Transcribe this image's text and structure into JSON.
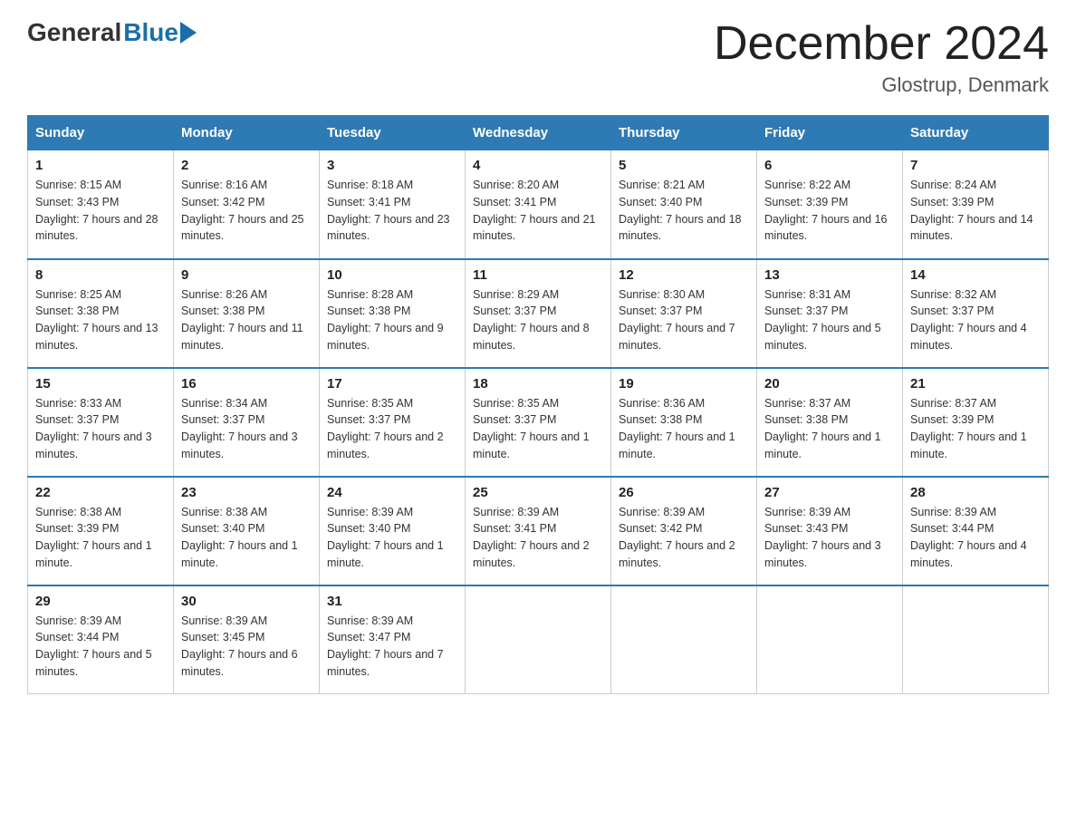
{
  "header": {
    "logo_general": "General",
    "logo_blue": "Blue",
    "title": "December 2024",
    "location": "Glostrup, Denmark"
  },
  "calendar": {
    "days_of_week": [
      "Sunday",
      "Monday",
      "Tuesday",
      "Wednesday",
      "Thursday",
      "Friday",
      "Saturday"
    ],
    "weeks": [
      [
        {
          "day": "1",
          "sunrise": "8:15 AM",
          "sunset": "3:43 PM",
          "daylight": "7 hours and 28 minutes."
        },
        {
          "day": "2",
          "sunrise": "8:16 AM",
          "sunset": "3:42 PM",
          "daylight": "7 hours and 25 minutes."
        },
        {
          "day": "3",
          "sunrise": "8:18 AM",
          "sunset": "3:41 PM",
          "daylight": "7 hours and 23 minutes."
        },
        {
          "day": "4",
          "sunrise": "8:20 AM",
          "sunset": "3:41 PM",
          "daylight": "7 hours and 21 minutes."
        },
        {
          "day": "5",
          "sunrise": "8:21 AM",
          "sunset": "3:40 PM",
          "daylight": "7 hours and 18 minutes."
        },
        {
          "day": "6",
          "sunrise": "8:22 AM",
          "sunset": "3:39 PM",
          "daylight": "7 hours and 16 minutes."
        },
        {
          "day": "7",
          "sunrise": "8:24 AM",
          "sunset": "3:39 PM",
          "daylight": "7 hours and 14 minutes."
        }
      ],
      [
        {
          "day": "8",
          "sunrise": "8:25 AM",
          "sunset": "3:38 PM",
          "daylight": "7 hours and 13 minutes."
        },
        {
          "day": "9",
          "sunrise": "8:26 AM",
          "sunset": "3:38 PM",
          "daylight": "7 hours and 11 minutes."
        },
        {
          "day": "10",
          "sunrise": "8:28 AM",
          "sunset": "3:38 PM",
          "daylight": "7 hours and 9 minutes."
        },
        {
          "day": "11",
          "sunrise": "8:29 AM",
          "sunset": "3:37 PM",
          "daylight": "7 hours and 8 minutes."
        },
        {
          "day": "12",
          "sunrise": "8:30 AM",
          "sunset": "3:37 PM",
          "daylight": "7 hours and 7 minutes."
        },
        {
          "day": "13",
          "sunrise": "8:31 AM",
          "sunset": "3:37 PM",
          "daylight": "7 hours and 5 minutes."
        },
        {
          "day": "14",
          "sunrise": "8:32 AM",
          "sunset": "3:37 PM",
          "daylight": "7 hours and 4 minutes."
        }
      ],
      [
        {
          "day": "15",
          "sunrise": "8:33 AM",
          "sunset": "3:37 PM",
          "daylight": "7 hours and 3 minutes."
        },
        {
          "day": "16",
          "sunrise": "8:34 AM",
          "sunset": "3:37 PM",
          "daylight": "7 hours and 3 minutes."
        },
        {
          "day": "17",
          "sunrise": "8:35 AM",
          "sunset": "3:37 PM",
          "daylight": "7 hours and 2 minutes."
        },
        {
          "day": "18",
          "sunrise": "8:35 AM",
          "sunset": "3:37 PM",
          "daylight": "7 hours and 1 minute."
        },
        {
          "day": "19",
          "sunrise": "8:36 AM",
          "sunset": "3:38 PM",
          "daylight": "7 hours and 1 minute."
        },
        {
          "day": "20",
          "sunrise": "8:37 AM",
          "sunset": "3:38 PM",
          "daylight": "7 hours and 1 minute."
        },
        {
          "day": "21",
          "sunrise": "8:37 AM",
          "sunset": "3:39 PM",
          "daylight": "7 hours and 1 minute."
        }
      ],
      [
        {
          "day": "22",
          "sunrise": "8:38 AM",
          "sunset": "3:39 PM",
          "daylight": "7 hours and 1 minute."
        },
        {
          "day": "23",
          "sunrise": "8:38 AM",
          "sunset": "3:40 PM",
          "daylight": "7 hours and 1 minute."
        },
        {
          "day": "24",
          "sunrise": "8:39 AM",
          "sunset": "3:40 PM",
          "daylight": "7 hours and 1 minute."
        },
        {
          "day": "25",
          "sunrise": "8:39 AM",
          "sunset": "3:41 PM",
          "daylight": "7 hours and 2 minutes."
        },
        {
          "day": "26",
          "sunrise": "8:39 AM",
          "sunset": "3:42 PM",
          "daylight": "7 hours and 2 minutes."
        },
        {
          "day": "27",
          "sunrise": "8:39 AM",
          "sunset": "3:43 PM",
          "daylight": "7 hours and 3 minutes."
        },
        {
          "day": "28",
          "sunrise": "8:39 AM",
          "sunset": "3:44 PM",
          "daylight": "7 hours and 4 minutes."
        }
      ],
      [
        {
          "day": "29",
          "sunrise": "8:39 AM",
          "sunset": "3:44 PM",
          "daylight": "7 hours and 5 minutes."
        },
        {
          "day": "30",
          "sunrise": "8:39 AM",
          "sunset": "3:45 PM",
          "daylight": "7 hours and 6 minutes."
        },
        {
          "day": "31",
          "sunrise": "8:39 AM",
          "sunset": "3:47 PM",
          "daylight": "7 hours and 7 minutes."
        },
        null,
        null,
        null,
        null
      ]
    ]
  }
}
